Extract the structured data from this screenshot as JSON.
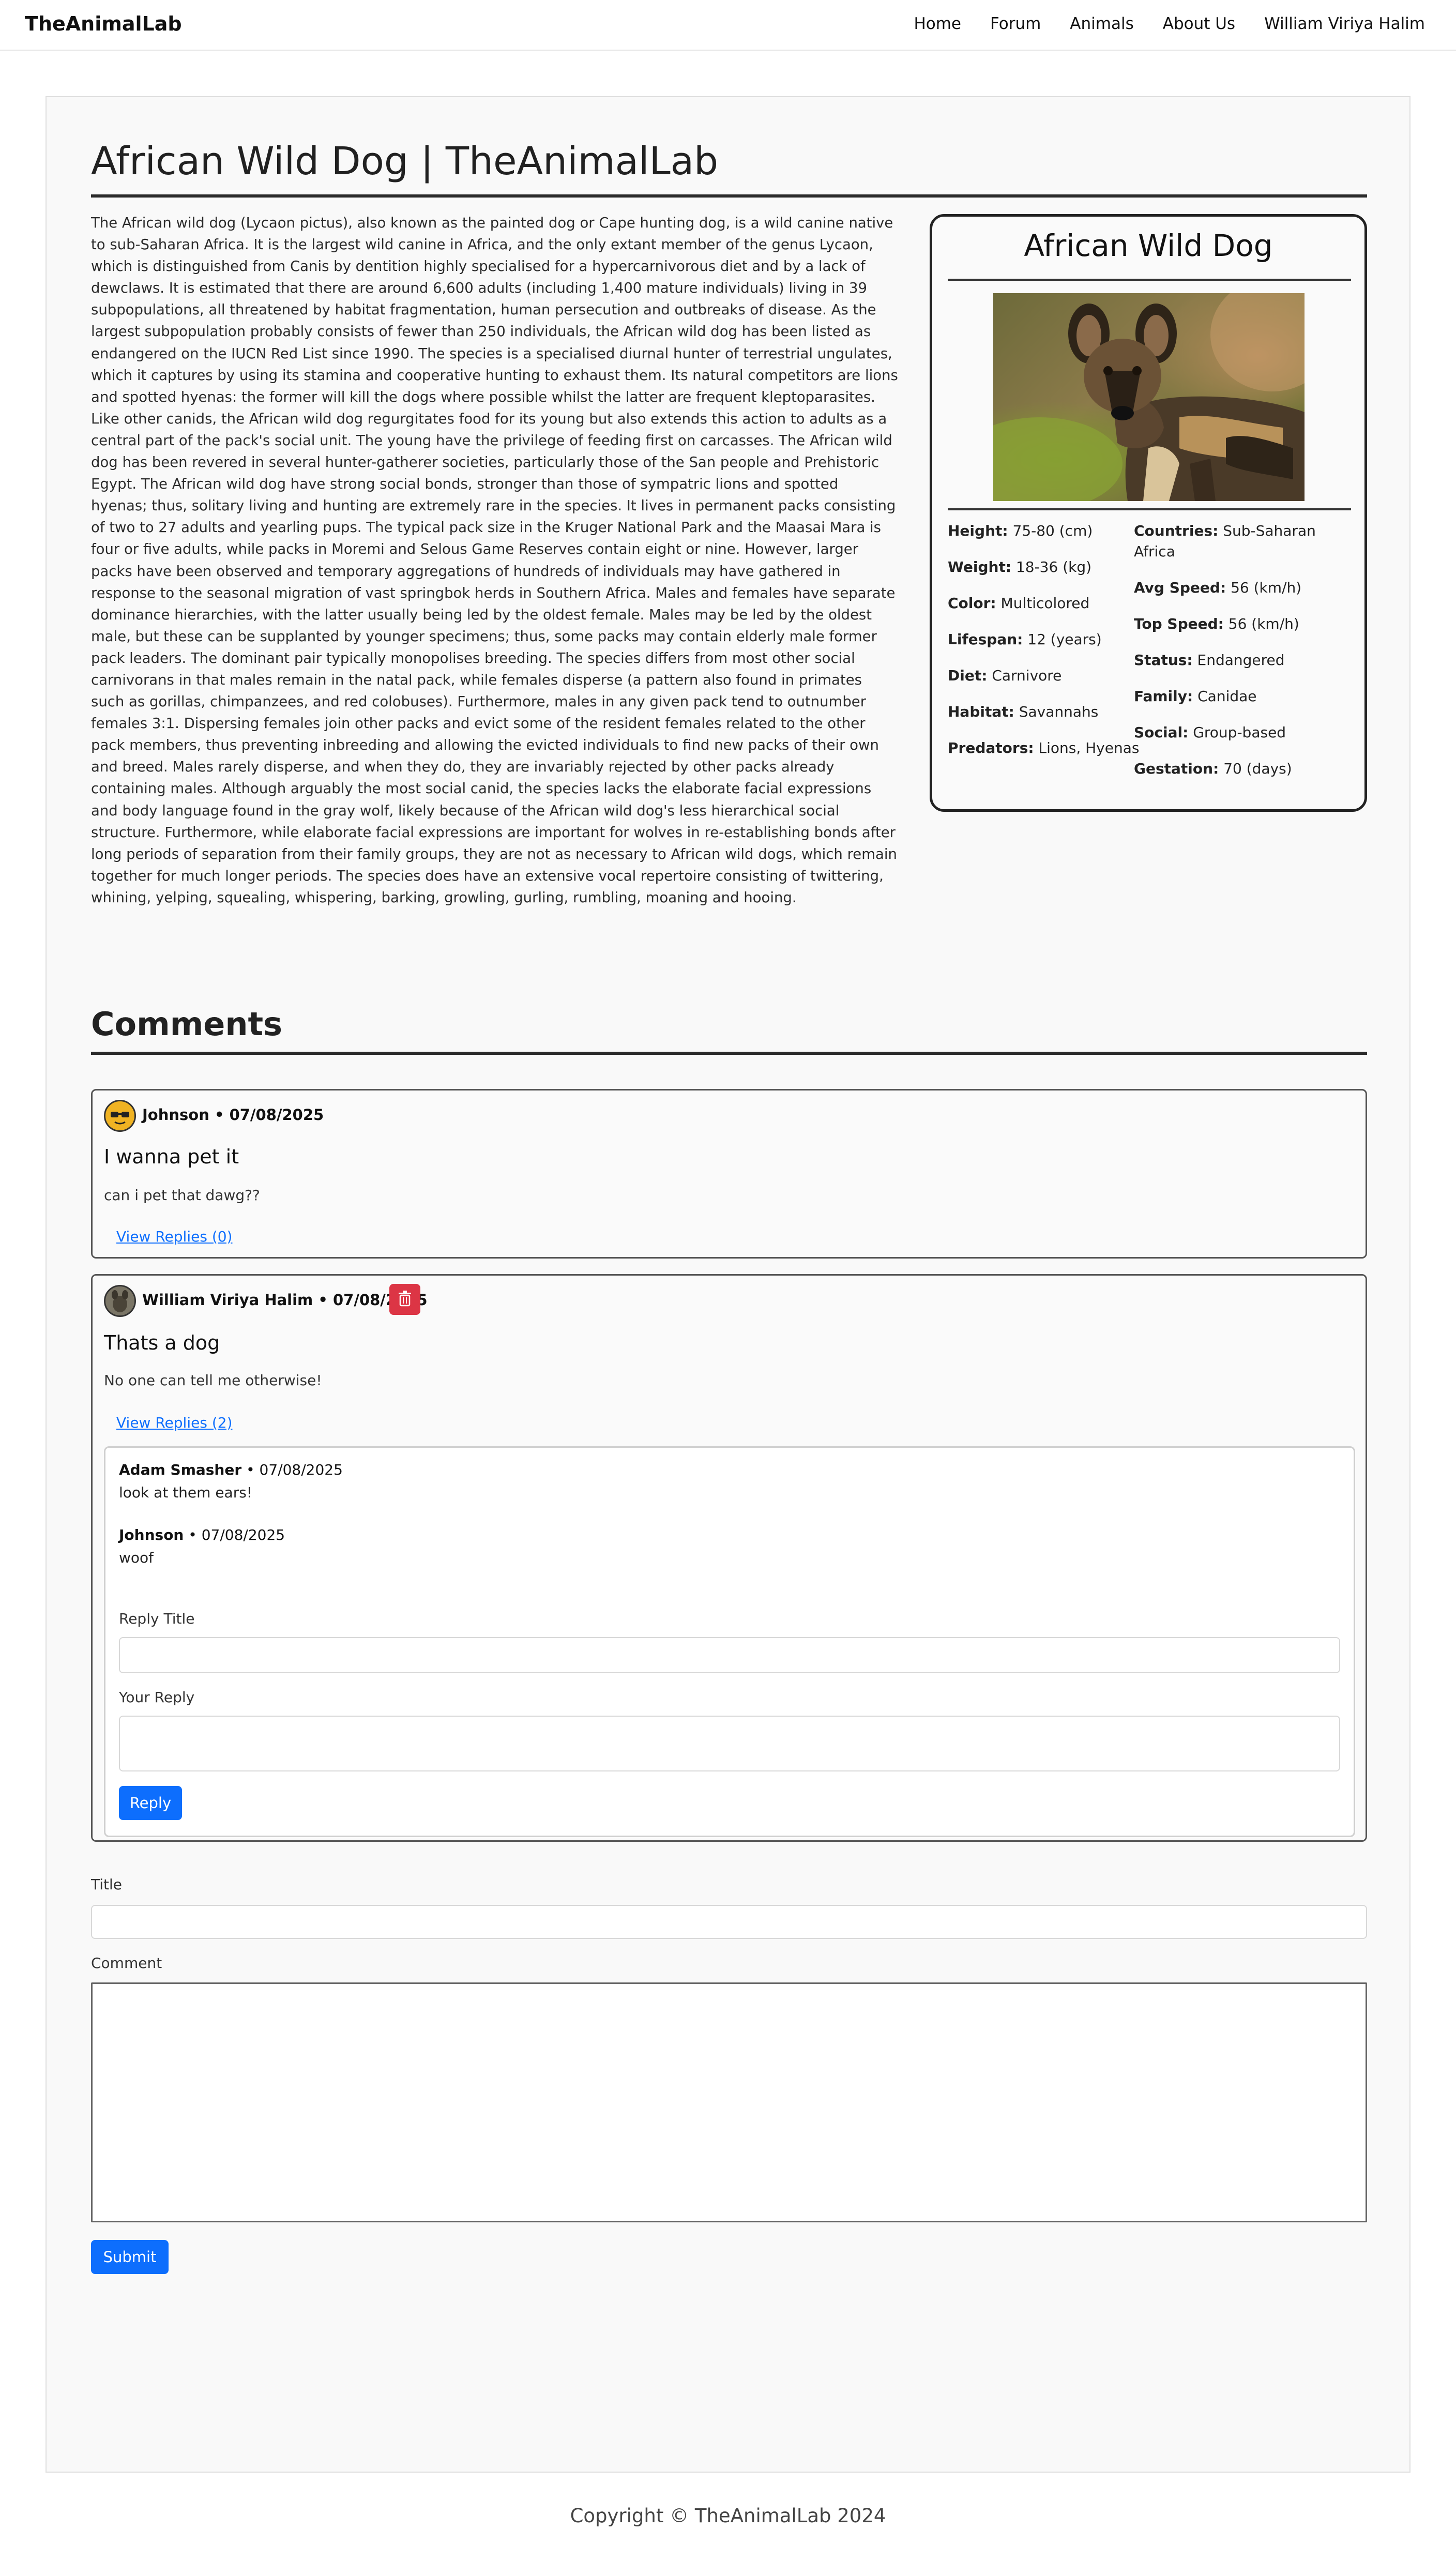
{
  "nav": {
    "brand": "TheAnimalLab",
    "links": [
      "Home",
      "Forum",
      "Animals",
      "About Us",
      "William Viriya Halim"
    ]
  },
  "page": {
    "title": "African Wild Dog | TheAnimalLab",
    "article": "The African wild dog (Lycaon pictus), also known as the painted dog or Cape hunting dog, is a wild canine native to sub-Saharan Africa. It is the largest wild canine in Africa, and the only extant member of the genus Lycaon, which is distinguished from Canis by dentition highly specialised for a hypercarnivorous diet and by a lack of dewclaws. It is estimated that there are around 6,600 adults (including 1,400 mature individuals) living in 39 subpopulations, all threatened by habitat fragmentation, human persecution and outbreaks of disease. As the largest subpopulation probably consists of fewer than 250 individuals, the African wild dog has been listed as endangered on the IUCN Red List since 1990. The species is a specialised diurnal hunter of terrestrial ungulates, which it captures by using its stamina and cooperative hunting to exhaust them. Its natural competitors are lions and spotted hyenas: the former will kill the dogs where possible whilst the latter are frequent kleptoparasites. Like other canids, the African wild dog regurgitates food for its young but also extends this action to adults as a central part of the pack's social unit. The young have the privilege of feeding first on carcasses. The African wild dog has been revered in several hunter-gatherer societies, particularly those of the San people and Prehistoric Egypt. The African wild dog have strong social bonds, stronger than those of sympatric lions and spotted hyenas; thus, solitary living and hunting are extremely rare in the species. It lives in permanent packs consisting of two to 27 adults and yearling pups. The typical pack size in the Kruger National Park and the Maasai Mara is four or five adults, while packs in Moremi and Selous Game Reserves contain eight or nine. However, larger packs have been observed and temporary aggregations of hundreds of individuals may have gathered in response to the seasonal migration of vast springbok herds in Southern Africa. Males and females have separate dominance hierarchies, with the latter usually being led by the oldest female. Males may be led by the oldest male, but these can be supplanted by younger specimens; thus, some packs may contain elderly male former pack leaders. The dominant pair typically monopolises breeding. The species differs from most other social carnivorans in that males remain in the natal pack, while females disperse (a pattern also found in primates such as gorillas, chimpanzees, and red colobuses). Furthermore, males in any given pack tend to outnumber females 3:1. Dispersing females join other packs and evict some of the resident females related to the other pack members, thus preventing inbreeding and allowing the evicted individuals to find new packs of their own and breed. Males rarely disperse, and when they do, they are invariably rejected by other packs already containing males. Although arguably the most social canid, the species lacks the elaborate facial expressions and body language found in the gray wolf, likely because of the African wild dog's less hierarchical social structure. Furthermore, while elaborate facial expressions are important for wolves in re-establishing bonds after long periods of separation from their family groups, they are not as necessary to African wild dogs, which remain together for much longer periods. The species does have an extensive vocal repertoire consisting of twittering, whining, yelping, squealing, whispering, barking, growling, gurling, rumbling, moaning and hooing."
  },
  "infobox": {
    "title": "African Wild Dog",
    "left": [
      {
        "label": "Height:",
        "value": "75-80 (cm)"
      },
      {
        "label": "Weight:",
        "value": "18-36 (kg)"
      },
      {
        "label": "Color:",
        "value": "Multicolored"
      },
      {
        "label": "Lifespan:",
        "value": "12 (years)"
      },
      {
        "label": "Diet:",
        "value": "Carnivore"
      },
      {
        "label": "Habitat:",
        "value": "Savannahs"
      },
      {
        "label": "Predators:",
        "value": "Lions, Hyenas"
      }
    ],
    "right": [
      {
        "label": "Countries:",
        "value": "Sub-Saharan Africa"
      },
      {
        "label": "Avg Speed:",
        "value": "56 (km/h)"
      },
      {
        "label": "Top Speed:",
        "value": "56 (km/h)"
      },
      {
        "label": "Status:",
        "value": "Endangered"
      },
      {
        "label": "Family:",
        "value": "Canidae"
      },
      {
        "label": "Social:",
        "value": "Group-based"
      },
      {
        "label": "Gestation:",
        "value": "70 (days)"
      }
    ]
  },
  "comments": {
    "heading": "Comments",
    "items": [
      {
        "author": "Johnson",
        "date": "07/08/2025",
        "title": "I wanna pet it",
        "body": "can i pet that dawg??",
        "replies_link": "View Replies (0)"
      },
      {
        "author": "William Viriya Halim",
        "date": "07/08/2025",
        "title": "Thats a dog",
        "body": "No one can tell me otherwise!",
        "replies_link": "View Replies (2)",
        "replies": [
          {
            "author": "Adam Smasher",
            "date": "07/08/2025",
            "text": "look at them ears!"
          },
          {
            "author": "Johnson",
            "date": "07/08/2025",
            "text": "woof"
          }
        ],
        "reply_form": {
          "title_label": "Reply Title",
          "body_label": "Your Reply",
          "button": "Reply"
        }
      }
    ]
  },
  "comment_form": {
    "title_label": "Title",
    "body_label": "Comment",
    "button": "Submit"
  },
  "footer": "Copyright © TheAnimalLab 2024",
  "colors": {
    "primary": "#0d6efd",
    "danger": "#dc3545"
  }
}
